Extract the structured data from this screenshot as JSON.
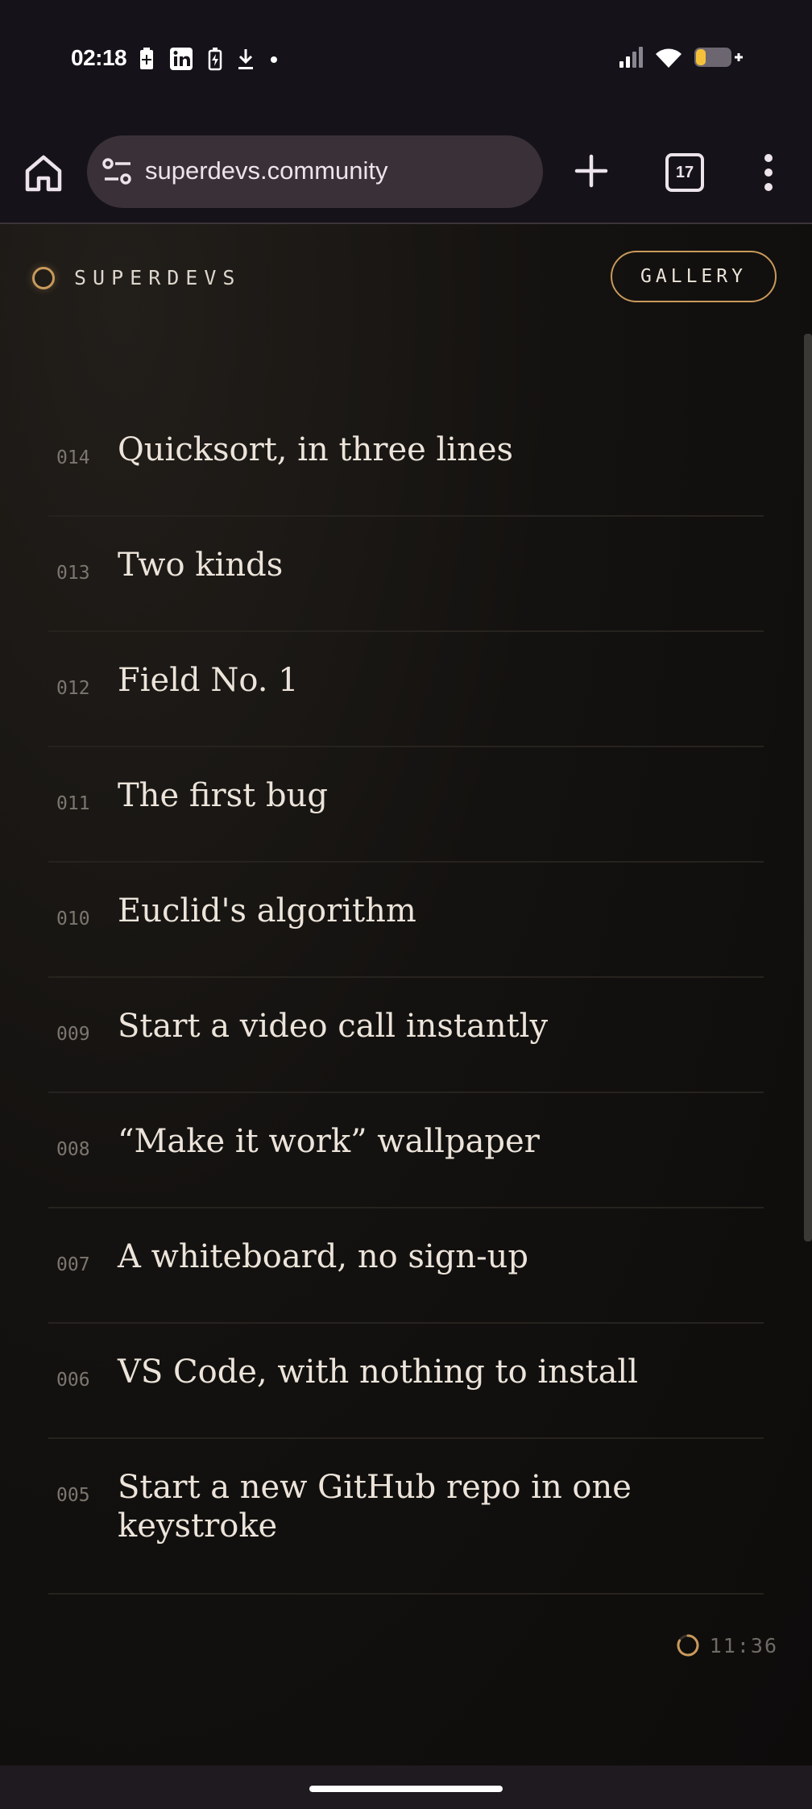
{
  "status_bar": {
    "time": "02:18",
    "icons_left": [
      "battery-saver-icon",
      "linkedin-icon",
      "battery-charging-icon",
      "download-icon",
      "dot-icon"
    ],
    "icons_right": [
      "signal-icon",
      "wifi-icon",
      "battery-icon"
    ],
    "battery_color": "#f5c13b"
  },
  "browser": {
    "url": "superdevs.community",
    "tab_count": "17"
  },
  "site": {
    "brand": "SUPERDEVS",
    "gallery_label": "GALLERY",
    "accent_color": "#c99a5b"
  },
  "list": [
    {
      "num": "014",
      "title": "Quicksort, in three lines"
    },
    {
      "num": "013",
      "title": "Two kinds"
    },
    {
      "num": "012",
      "title": "Field No. 1"
    },
    {
      "num": "011",
      "title": "The first bug"
    },
    {
      "num": "010",
      "title": "Euclid's algorithm"
    },
    {
      "num": "009",
      "title": "Start a video call instantly"
    },
    {
      "num": "008",
      "title": "“Make it work” wallpaper"
    },
    {
      "num": "007",
      "title": "A whiteboard, no sign-up"
    },
    {
      "num": "006",
      "title": "VS Code, with nothing to install"
    },
    {
      "num": "005",
      "title": "Start a new GitHub repo in one keystroke"
    }
  ],
  "footer": {
    "time": "11:36"
  }
}
